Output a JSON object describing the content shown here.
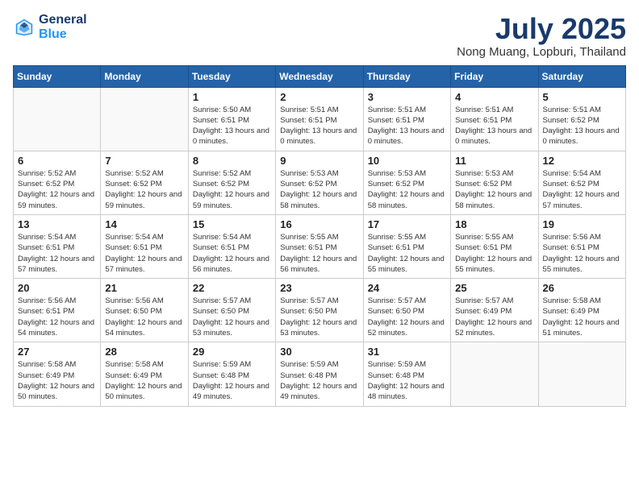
{
  "header": {
    "logo_line1": "General",
    "logo_line2": "Blue",
    "month": "July 2025",
    "location": "Nong Muang, Lopburi, Thailand"
  },
  "days_of_week": [
    "Sunday",
    "Monday",
    "Tuesday",
    "Wednesday",
    "Thursday",
    "Friday",
    "Saturday"
  ],
  "weeks": [
    [
      {
        "day": "",
        "info": ""
      },
      {
        "day": "",
        "info": ""
      },
      {
        "day": "1",
        "info": "Sunrise: 5:50 AM\nSunset: 6:51 PM\nDaylight: 13 hours and 0 minutes."
      },
      {
        "day": "2",
        "info": "Sunrise: 5:51 AM\nSunset: 6:51 PM\nDaylight: 13 hours and 0 minutes."
      },
      {
        "day": "3",
        "info": "Sunrise: 5:51 AM\nSunset: 6:51 PM\nDaylight: 13 hours and 0 minutes."
      },
      {
        "day": "4",
        "info": "Sunrise: 5:51 AM\nSunset: 6:51 PM\nDaylight: 13 hours and 0 minutes."
      },
      {
        "day": "5",
        "info": "Sunrise: 5:51 AM\nSunset: 6:52 PM\nDaylight: 13 hours and 0 minutes."
      }
    ],
    [
      {
        "day": "6",
        "info": "Sunrise: 5:52 AM\nSunset: 6:52 PM\nDaylight: 12 hours and 59 minutes."
      },
      {
        "day": "7",
        "info": "Sunrise: 5:52 AM\nSunset: 6:52 PM\nDaylight: 12 hours and 59 minutes."
      },
      {
        "day": "8",
        "info": "Sunrise: 5:52 AM\nSunset: 6:52 PM\nDaylight: 12 hours and 59 minutes."
      },
      {
        "day": "9",
        "info": "Sunrise: 5:53 AM\nSunset: 6:52 PM\nDaylight: 12 hours and 58 minutes."
      },
      {
        "day": "10",
        "info": "Sunrise: 5:53 AM\nSunset: 6:52 PM\nDaylight: 12 hours and 58 minutes."
      },
      {
        "day": "11",
        "info": "Sunrise: 5:53 AM\nSunset: 6:52 PM\nDaylight: 12 hours and 58 minutes."
      },
      {
        "day": "12",
        "info": "Sunrise: 5:54 AM\nSunset: 6:52 PM\nDaylight: 12 hours and 57 minutes."
      }
    ],
    [
      {
        "day": "13",
        "info": "Sunrise: 5:54 AM\nSunset: 6:51 PM\nDaylight: 12 hours and 57 minutes."
      },
      {
        "day": "14",
        "info": "Sunrise: 5:54 AM\nSunset: 6:51 PM\nDaylight: 12 hours and 57 minutes."
      },
      {
        "day": "15",
        "info": "Sunrise: 5:54 AM\nSunset: 6:51 PM\nDaylight: 12 hours and 56 minutes."
      },
      {
        "day": "16",
        "info": "Sunrise: 5:55 AM\nSunset: 6:51 PM\nDaylight: 12 hours and 56 minutes."
      },
      {
        "day": "17",
        "info": "Sunrise: 5:55 AM\nSunset: 6:51 PM\nDaylight: 12 hours and 55 minutes."
      },
      {
        "day": "18",
        "info": "Sunrise: 5:55 AM\nSunset: 6:51 PM\nDaylight: 12 hours and 55 minutes."
      },
      {
        "day": "19",
        "info": "Sunrise: 5:56 AM\nSunset: 6:51 PM\nDaylight: 12 hours and 55 minutes."
      }
    ],
    [
      {
        "day": "20",
        "info": "Sunrise: 5:56 AM\nSunset: 6:51 PM\nDaylight: 12 hours and 54 minutes."
      },
      {
        "day": "21",
        "info": "Sunrise: 5:56 AM\nSunset: 6:50 PM\nDaylight: 12 hours and 54 minutes."
      },
      {
        "day": "22",
        "info": "Sunrise: 5:57 AM\nSunset: 6:50 PM\nDaylight: 12 hours and 53 minutes."
      },
      {
        "day": "23",
        "info": "Sunrise: 5:57 AM\nSunset: 6:50 PM\nDaylight: 12 hours and 53 minutes."
      },
      {
        "day": "24",
        "info": "Sunrise: 5:57 AM\nSunset: 6:50 PM\nDaylight: 12 hours and 52 minutes."
      },
      {
        "day": "25",
        "info": "Sunrise: 5:57 AM\nSunset: 6:49 PM\nDaylight: 12 hours and 52 minutes."
      },
      {
        "day": "26",
        "info": "Sunrise: 5:58 AM\nSunset: 6:49 PM\nDaylight: 12 hours and 51 minutes."
      }
    ],
    [
      {
        "day": "27",
        "info": "Sunrise: 5:58 AM\nSunset: 6:49 PM\nDaylight: 12 hours and 50 minutes."
      },
      {
        "day": "28",
        "info": "Sunrise: 5:58 AM\nSunset: 6:49 PM\nDaylight: 12 hours and 50 minutes."
      },
      {
        "day": "29",
        "info": "Sunrise: 5:59 AM\nSunset: 6:48 PM\nDaylight: 12 hours and 49 minutes."
      },
      {
        "day": "30",
        "info": "Sunrise: 5:59 AM\nSunset: 6:48 PM\nDaylight: 12 hours and 49 minutes."
      },
      {
        "day": "31",
        "info": "Sunrise: 5:59 AM\nSunset: 6:48 PM\nDaylight: 12 hours and 48 minutes."
      },
      {
        "day": "",
        "info": ""
      },
      {
        "day": "",
        "info": ""
      }
    ]
  ]
}
